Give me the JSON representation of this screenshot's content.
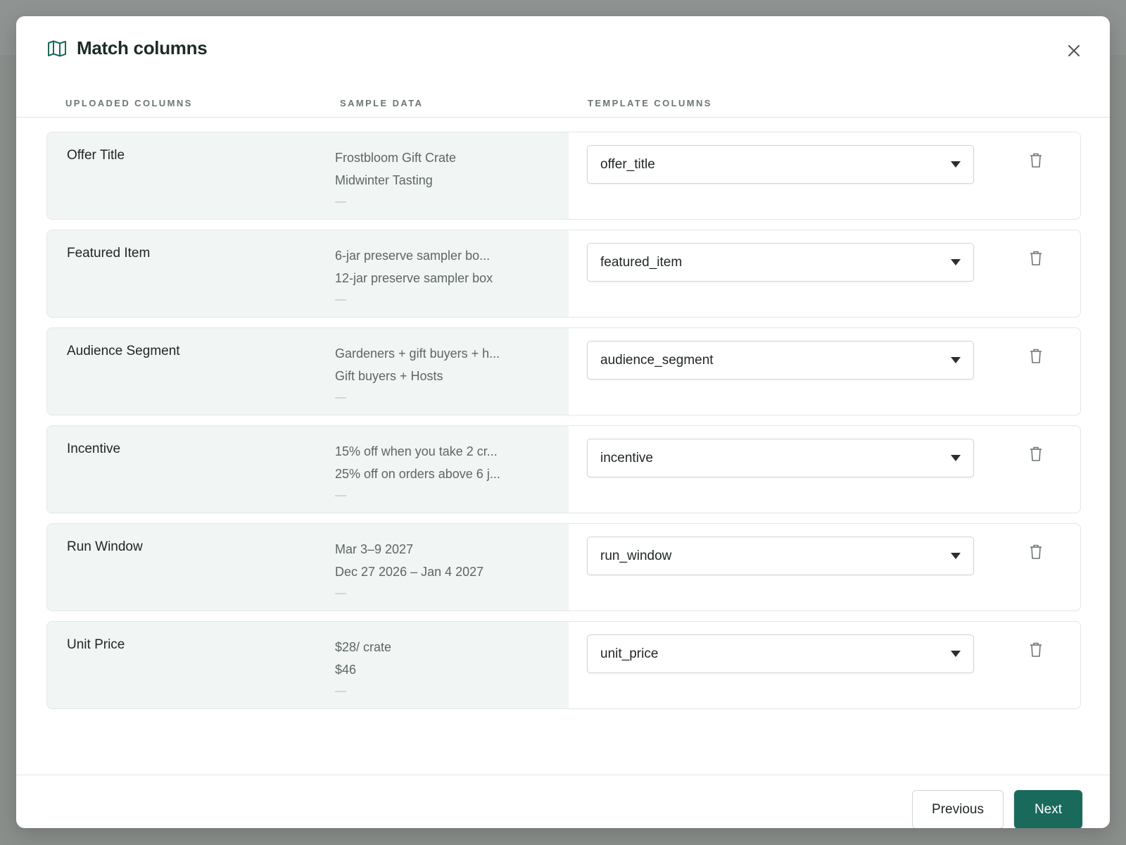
{
  "modal": {
    "title": "Match columns",
    "title_icon": "map-icon",
    "close_icon": "close-icon"
  },
  "columns": {
    "uploaded": "UPLOADED COLUMNS",
    "sample": "SAMPLE DATA",
    "template": "TEMPLATE COLUMNS"
  },
  "rows": [
    {
      "name": "Offer Title",
      "samples": [
        "Frostbloom Gift Crate",
        "Midwinter Tasting"
      ],
      "empty_marker": "—",
      "template": "offer_title"
    },
    {
      "name": "Featured Item",
      "samples": [
        "6-jar preserve sampler bo...",
        "12-jar preserve sampler box"
      ],
      "empty_marker": "—",
      "template": "featured_item"
    },
    {
      "name": "Audience Segment",
      "samples": [
        "Gardeners + gift buyers + h...",
        "Gift buyers + Hosts"
      ],
      "empty_marker": "—",
      "template": "audience_segment"
    },
    {
      "name": "Incentive",
      "samples": [
        "15% off when you take 2 cr...",
        "25% off on orders above 6 j..."
      ],
      "empty_marker": "—",
      "template": "incentive"
    },
    {
      "name": "Run Window",
      "samples": [
        "Mar 3–9 2027",
        "Dec 27 2026 – Jan 4 2027"
      ],
      "empty_marker": "—",
      "template": "run_window"
    },
    {
      "name": "Unit Price",
      "samples": [
        "$28/ crate",
        "$46"
      ],
      "empty_marker": "—",
      "template": "unit_price"
    }
  ],
  "footer": {
    "previous_label": "Previous",
    "next_label": "Next"
  },
  "colors": {
    "accent": "#1a6a5c",
    "row_left_bg": "#f1f5f4",
    "backdrop": "#8b8f8c"
  }
}
